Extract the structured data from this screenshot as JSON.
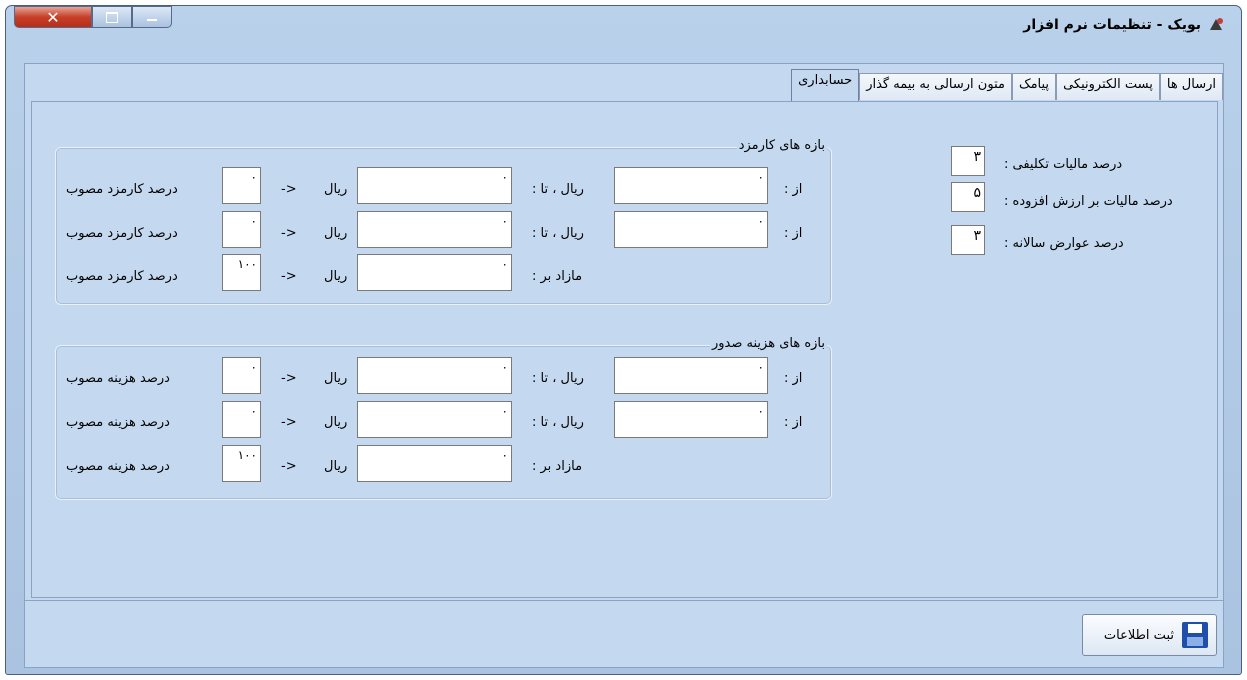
{
  "window": {
    "title": "بویک - تنظیمات نرم افزار"
  },
  "tabs": [
    "ارسال ها",
    "پست الکترونیکی",
    "پیامک",
    "متون ارسالی به بیمه گذار",
    "حسابداری"
  ],
  "tax": {
    "rows": [
      {
        "label": "درصد مالیات تکلیفی :",
        "value": "۳"
      },
      {
        "label": "درصد مالیات بر ارزش افزوده :",
        "value": "۵"
      },
      {
        "label": "درصد عوارض سالانه :",
        "value": "۳"
      }
    ]
  },
  "labels": {
    "from": "از :",
    "rial_to": "ریال ، تا :",
    "above": "مازاد بر :",
    "rial": "ریال",
    "arrow": "->"
  },
  "commission": {
    "title": "بازه های کارمزد",
    "pct_label": "درصد کارمزد مصوب",
    "rows": [
      {
        "from": "۰",
        "to": "۰",
        "pct": "۰"
      },
      {
        "from": "۰",
        "to": "۰",
        "pct": "۰"
      },
      {
        "to": "۰",
        "pct": "۱۰۰"
      }
    ]
  },
  "issuance": {
    "title": "بازه های هزینه صدور",
    "pct_label": "درصد هزینه مصوب",
    "rows": [
      {
        "from": "۰",
        "to": "۰",
        "pct": "۰"
      },
      {
        "from": "۰",
        "to": "۰",
        "pct": "۰"
      },
      {
        "to": "۰",
        "pct": "۱۰۰"
      }
    ]
  },
  "actions": {
    "save_label": "ثبت اطلاعات"
  }
}
